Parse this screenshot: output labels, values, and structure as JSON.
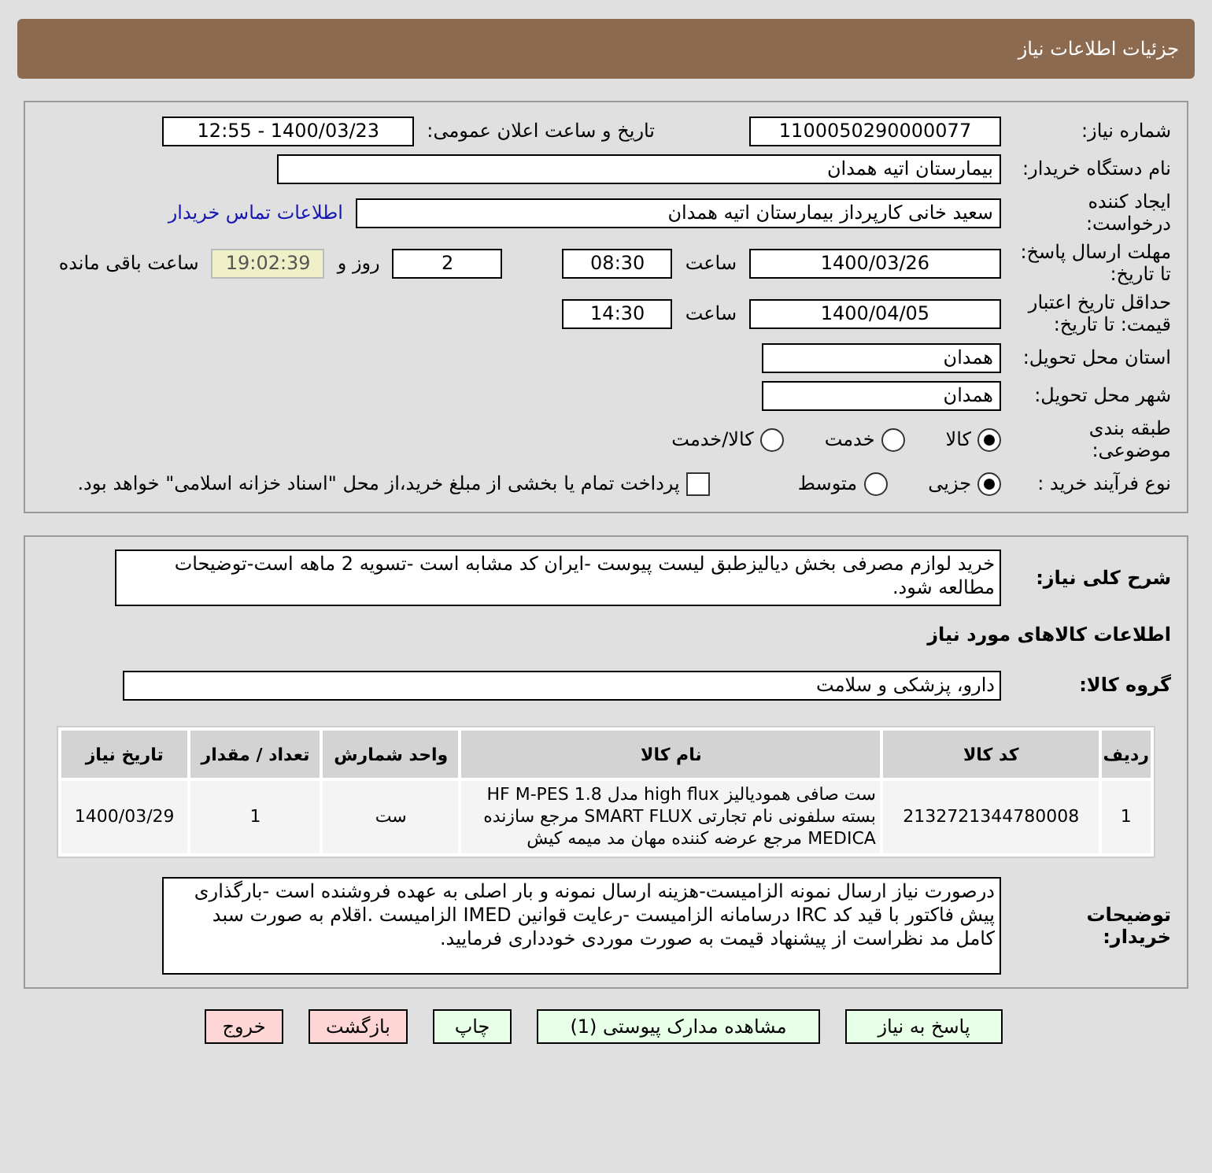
{
  "header": {
    "title": "جزئیات اطلاعات نیاز"
  },
  "need_number": {
    "label": "شماره نیاز:",
    "value": "1100050290000077"
  },
  "announce": {
    "label": "تاریخ و ساعت اعلان عمومی:",
    "value": "1400/03/23 - 12:55"
  },
  "buyer_org": {
    "label": "نام دستگاه خریدار:",
    "value": "بیمارستان اتیه همدان"
  },
  "creator": {
    "label": "ایجاد کننده درخواست:",
    "value": "سعید خانی کارپرداز بیمارستان اتیه همدان",
    "link": "اطلاعات تماس خریدار"
  },
  "deadline": {
    "label": "مهلت ارسال پاسخ: تا تاریخ:",
    "date": "1400/03/26",
    "time_label": "ساعت",
    "time": "08:30",
    "days": "2",
    "days_label": "روز و",
    "remaining": "19:02:39",
    "remaining_label": "ساعت باقی مانده"
  },
  "validity": {
    "label": "حداقل تاریخ اعتبار قیمت: تا تاریخ:",
    "date": "1400/04/05",
    "time_label": "ساعت",
    "time": "14:30"
  },
  "province": {
    "label": "استان محل تحویل:",
    "value": "همدان"
  },
  "city": {
    "label": "شهر محل تحویل:",
    "value": "همدان"
  },
  "category": {
    "label": "طبقه بندی موضوعی:",
    "options": [
      {
        "label": "کالا",
        "selected": true
      },
      {
        "label": "خدمت",
        "selected": false
      },
      {
        "label": "کالا/خدمت",
        "selected": false
      }
    ]
  },
  "process": {
    "label": "نوع فرآیند خرید :",
    "options": [
      {
        "label": "جزیی",
        "selected": true
      },
      {
        "label": "متوسط",
        "selected": false
      }
    ],
    "payment": {
      "label": "پرداخت تمام یا بخشی از مبلغ خرید،از محل \"اسناد خزانه اسلامی\" خواهد بود.",
      "checked": false
    }
  },
  "description": {
    "label": "شرح کلی نیاز:",
    "value": "خرید لوازم مصرفی بخش دیالیزطبق لیست پیوست -ایران کد مشابه است -تسویه 2 ماهه است-توضیحات مطالعه شود."
  },
  "goods_title": "اطلاعات کالاهای مورد نیاز",
  "goods_group": {
    "label": "گروه کالا:",
    "value": "دارو، پزشکی و سلامت"
  },
  "table": {
    "columns": [
      "ردیف",
      "کد کالا",
      "نام کالا",
      "واحد شمارش",
      "تعداد / مقدار",
      "تاریخ نیاز"
    ],
    "rows": [
      [
        "1",
        "2132721344780008",
        "ست صافی همودیالیز high flux مدل HF M-PES 1.8 بسته سلفونی نام تجارتی SMART FLUX مرجع سازنده MEDICA مرجع عرضه کننده مهان مد میمه کیش",
        "ست",
        "1",
        "1400/03/29"
      ]
    ]
  },
  "buyer_notes": {
    "label": "توضیحات خریدار:",
    "value": "درصورت نیاز ارسال نمونه الزامیست-هزینه ارسال نمونه و بار اصلی به عهده فروشنده است -بارگذاری پیش فاکتور با قید کد IRC درسامانه الزامیست -رعایت قوانین IMED الزامیست .اقلام به صورت سبد کامل مد نظراست از پیشنهاد قیمت به صورت موردی خودداری فرمایید."
  },
  "buttons": [
    {
      "label": "پاسخ به نیاز",
      "kind": "primary"
    },
    {
      "label": "مشاهده مدارک پیوستی (1)",
      "kind": "primary"
    },
    {
      "label": "چاپ",
      "kind": "primary"
    },
    {
      "label": "بازگشت",
      "kind": "danger"
    },
    {
      "label": "خروج",
      "kind": "danger"
    }
  ]
}
